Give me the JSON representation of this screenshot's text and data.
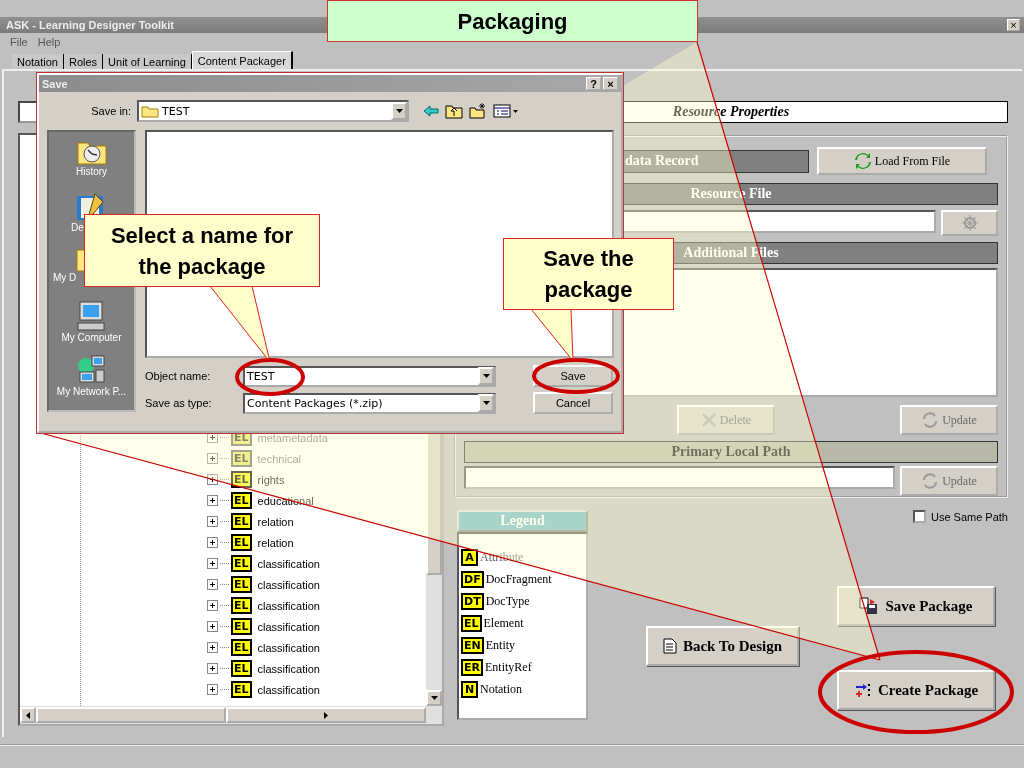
{
  "banner": {
    "title": "Packaging"
  },
  "window": {
    "title": "ASK - Learning Designer Toolkit",
    "close": "×"
  },
  "menu": [
    "File",
    "Help"
  ],
  "tabs": [
    {
      "label": "Notation",
      "selected": false
    },
    {
      "label": "Roles",
      "selected": false
    },
    {
      "label": "Unit of Learning",
      "selected": false
    },
    {
      "label": "Content Packager",
      "selected": true
    }
  ],
  "tree": {
    "items": [
      {
        "badge": "EL",
        "label": "metametadata",
        "disabled": true
      },
      {
        "badge": "EL",
        "label": "technical",
        "disabled": true
      },
      {
        "badge": "EL",
        "label": "rights",
        "disabled": false
      },
      {
        "badge": "EL",
        "label": "educational",
        "disabled": false
      },
      {
        "badge": "EL",
        "label": "relation",
        "disabled": false
      },
      {
        "badge": "EL",
        "label": "relation",
        "disabled": false
      },
      {
        "badge": "EL",
        "label": "classification",
        "disabled": false
      },
      {
        "badge": "EL",
        "label": "classification",
        "disabled": false
      },
      {
        "badge": "EL",
        "label": "classification",
        "disabled": false
      },
      {
        "badge": "EL",
        "label": "classification",
        "disabled": false
      },
      {
        "badge": "EL",
        "label": "classification",
        "disabled": false
      },
      {
        "badge": "EL",
        "label": "classification",
        "disabled": false
      },
      {
        "badge": "EL",
        "label": "classification",
        "disabled": false
      }
    ]
  },
  "properties": {
    "title": "Resource Properties",
    "record_header": "data Record",
    "load_button": "Load From File",
    "resource_header": "Resource File",
    "additional_header": "Additional Files",
    "delete_button": {
      "label": "Delete",
      "disabled": true
    },
    "update_button": {
      "label": "Update",
      "disabled": true
    },
    "path_header": {
      "label": "Primary Local Path",
      "disabled": true
    },
    "path_update_button": {
      "label": "Update",
      "disabled": true
    }
  },
  "use_same_path": {
    "label": "Use Same Path",
    "checked": false
  },
  "legend": {
    "title": "Legend",
    "items": [
      {
        "badge": "A",
        "label": "Attribute",
        "disabled": true
      },
      {
        "badge": "DF",
        "label": "DocFragment",
        "disabled": false
      },
      {
        "badge": "DT",
        "label": "DocType",
        "disabled": false
      },
      {
        "badge": "EL",
        "label": "Element",
        "disabled": false
      },
      {
        "badge": "EN",
        "label": "Entity",
        "disabled": false
      },
      {
        "badge": "ER",
        "label": "EntityRef",
        "disabled": false
      },
      {
        "badge": "N",
        "label": "Notation",
        "disabled": false
      }
    ]
  },
  "buttons": {
    "save_package": "Save Package",
    "back_to_design": "Back To Design",
    "create_package": "Create Package"
  },
  "dialog": {
    "title": "Save",
    "help": "?",
    "close": "×",
    "save_in_label": "Save in:",
    "save_in_value": "TEST",
    "places": [
      {
        "label": "History",
        "kind": "history"
      },
      {
        "label": "De",
        "kind": "desktop"
      },
      {
        "label": "My D",
        "kind": "documents"
      },
      {
        "label": "My Computer",
        "kind": "computer"
      },
      {
        "label": "My Network P...",
        "kind": "network"
      }
    ],
    "object_name_label": "Object name:",
    "object_name": "TEST",
    "type_label": "Save as type:",
    "type_value": "Content Packages (*.zip)",
    "save_button": "Save",
    "cancel_button": "Cancel"
  },
  "callouts": [
    {
      "text": "Select a name for the package"
    },
    {
      "text": "Save the package"
    }
  ]
}
